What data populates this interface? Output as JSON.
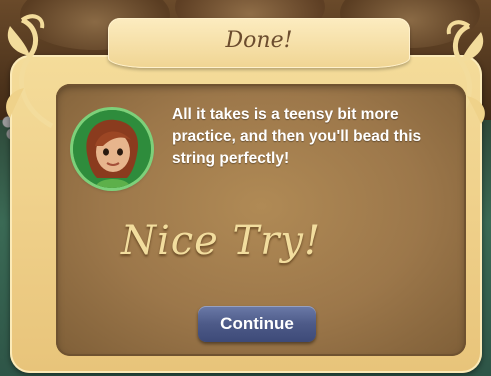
{
  "dialog": {
    "title": "Done!",
    "message": "All it takes is a teensy bit more practice, and then you'll bead this string perfectly!",
    "result": "Nice Try!",
    "continue_label": "Continue"
  },
  "colors": {
    "frame": "#f0d593",
    "panel": "#9c774a",
    "result_text": "#f2dd9e",
    "button": "#4d5a88",
    "avatar_ring": "#7dd07a"
  },
  "icons": {
    "avatar": "fairy-portrait",
    "decoration": "vine-ornament"
  }
}
